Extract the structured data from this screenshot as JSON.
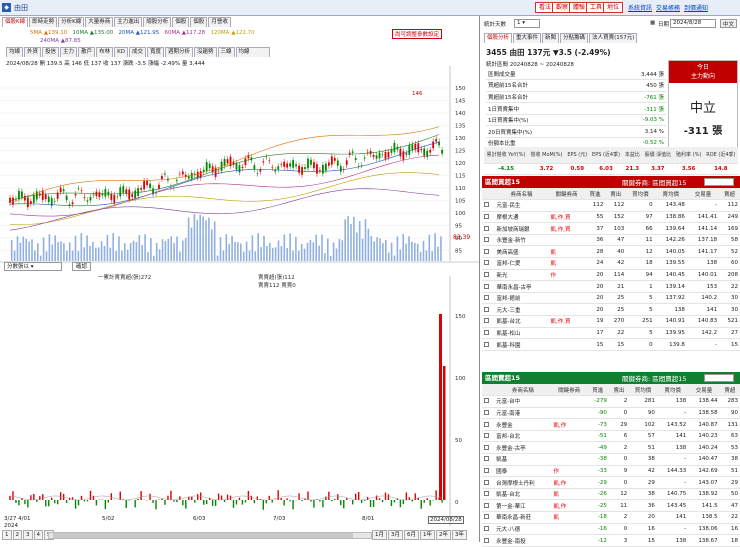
{
  "app": {
    "icon": "app-icon",
    "title": "由田",
    "links": [
      "看法",
      "觀察",
      "體驗",
      "工具",
      "地位"
    ],
    "top_links": [
      "系統資訊",
      "交易帳務",
      "到價通知"
    ]
  },
  "left": {
    "tabs": [
      "個股K線",
      "即時走勢",
      "分析K線",
      "大量券商",
      "主力進出",
      "總股分析",
      "個股",
      "個股",
      "月營收"
    ],
    "subtabs": [
      "均線",
      "外資",
      "投信",
      "主力",
      "散戶",
      "布林",
      "KD",
      "成交",
      "寬度",
      "週期分析",
      "沒趨勢",
      "三線",
      "均線"
    ],
    "ma_legend": [
      "5MA ▲139.10",
      "10MA ▲135.00",
      "20MA ▲121.95",
      "60MA ▲117.28",
      "240MA ▲87.85",
      "120MA ▲122.70"
    ],
    "ma_legend2": "240MA ▲87.85",
    "info": "2024/08/28  開 139.5  高 146  低 137  收 137   漲跌 -3.5  漲幅 -2.49%  量 3,444",
    "alert_link": "尚可調整參數設定",
    "price_ticks": [
      "150",
      "145",
      "140",
      "135",
      "130",
      "125",
      "120",
      "115",
      "110",
      "105",
      "100",
      "95",
      "90",
      "85"
    ],
    "last_price": "83.39",
    "high_label": "146",
    "vol_selector": "分數張以",
    "vol_legend": "一累計賣賣超(張)272",
    "vol_legend2": "賣賣超(張)112",
    "vol_legend3": "賣賣112 賣賣0",
    "sub_ticks": [
      "150",
      "100",
      "50",
      "0"
    ],
    "dates": [
      "3/27 4/01",
      "5/02",
      "6/03",
      "7/03",
      "8/01",
      "2024/08/28"
    ],
    "year": "2024",
    "pages": [
      "1",
      "2",
      "3",
      "4",
      "5"
    ],
    "ranges": [
      "1月",
      "3月",
      "6月",
      "1年",
      "2年",
      "3年"
    ]
  },
  "right": {
    "stat_title": "統計天數",
    "stat_days": "1",
    "date_label": "日期",
    "date_value": "2024/8/28",
    "next_btn": "中文",
    "tabs": [
      "個股分析",
      "重大事件",
      "新聞",
      "分點籌碼",
      "法人買賣(157元)"
    ],
    "stock_line": "3455 由田  137元 ▼3.5 (-2.49%)",
    "stat_period": "統計區間  20240828 ~ 20240828",
    "stats": [
      [
        "區間成交量",
        "3,444 張"
      ],
      [
        "買超前15名合計",
        "450 張"
      ],
      [
        "賣超前15名合計",
        "-761 張"
      ],
      [
        "1日買賣集中",
        "-311 張"
      ],
      [
        "1日買賣集中(%)",
        "-9.03 %"
      ],
      [
        "20日買賣集中(%)",
        "3.14 %"
      ],
      [
        "份額本比重",
        "-0.52 %"
      ],
      [
        "區間周轉率",
        "5.75 %"
      ]
    ],
    "main_label": "今日\n主力動向",
    "main_status": "中立",
    "main_value": "-311 張",
    "fund_heads": [
      "累計營收 YoY(%)",
      "營收 MoM(%)",
      "EPS (元)",
      "EPS (近4季)",
      "本益比",
      "股價 淨值比",
      "殖利率 (%)",
      "ROE (近4季)"
    ],
    "fund_vals": [
      "-4.15",
      "3.72",
      "0.59",
      "6.03",
      "21.3",
      "3.37",
      "3.56",
      "14.8"
    ],
    "buy_title": "區間買超15",
    "buy_select": "關鍵券商: 區間買超15",
    "sell_title": "區間賣超15",
    "sell_select": "關鍵券商: 區間賣超15",
    "cols": [
      "券商名稱",
      "關鍵券商",
      "買進",
      "賣出",
      "買均價",
      "賣均價",
      "交易量",
      "賣超"
    ],
    "buy_rows": [
      [
        "元富-民生",
        "",
        "112",
        "112",
        "0",
        "143.48",
        "-",
        "112",
        "-72"
      ],
      [
        "摩根大通",
        "凱,作,買",
        "55",
        "152",
        "97",
        "138.86",
        "141.41",
        "249",
        "15"
      ],
      [
        "新加坡商瑞銀",
        "凱,作,買",
        "37",
        "103",
        "66",
        "139.64",
        "141.14",
        "169",
        "0"
      ],
      [
        "永豐金-新竹",
        "",
        "36",
        "47",
        "11",
        "142.26",
        "137.18",
        "58",
        "-24"
      ],
      [
        "美商高盛",
        "凱",
        "28",
        "40",
        "12",
        "140.05",
        "141.17",
        "52",
        "-7"
      ],
      [
        "富邦-仁愛",
        "凱",
        "24",
        "42",
        "18",
        "139.55",
        "138",
        "60",
        "-9"
      ],
      [
        "新光",
        "作",
        "20",
        "114",
        "94",
        "140.45",
        "140.01",
        "208",
        "-11"
      ],
      [
        "華南永昌-古亭",
        "",
        "20",
        "21",
        "1",
        "139.14",
        "153",
        "22",
        "3"
      ],
      [
        "富邦-館前",
        "",
        "20",
        "25",
        "5",
        "137.92",
        "140.2",
        "30",
        "-1"
      ],
      [
        "元大-三重",
        "",
        "20",
        "25",
        "5",
        "138",
        "141",
        "30",
        "-11"
      ],
      [
        "凱基-台北",
        "凱,作,買",
        "19",
        "270",
        "251",
        "140.91",
        "140.83",
        "521",
        "-9"
      ],
      [
        "凱基-松山",
        "",
        "17",
        "22",
        "5",
        "139.95",
        "142.2",
        "27",
        "-4"
      ],
      [
        "凱基-科園",
        "",
        "15",
        "15",
        "0",
        "139.8",
        "-",
        "15",
        "-4"
      ]
    ],
    "sell_rows": [
      [
        "元富-台中",
        "",
        "-279",
        "2",
        "281",
        "138",
        "138.44",
        "283",
        "40"
      ],
      [
        "元富-南港",
        "",
        "-90",
        "0",
        "90",
        "-",
        "138.58",
        "90",
        "14"
      ],
      [
        "永豐金",
        "凱,作",
        "-73",
        "29",
        "102",
        "143.52",
        "140.87",
        "131",
        "21"
      ],
      [
        "富邦-台北",
        "",
        "-51",
        "6",
        "57",
        "141",
        "140.23",
        "63",
        "16"
      ],
      [
        "永豐金-古亭",
        "",
        "-49",
        "2",
        "51",
        "138",
        "140.24",
        "53",
        "16"
      ],
      [
        "凱基",
        "",
        "-38",
        "0",
        "38",
        "-",
        "140.47",
        "38",
        "13"
      ],
      [
        "國泰",
        "作",
        "-33",
        "9",
        "42",
        "144.33",
        "142.69",
        "51",
        "17"
      ],
      [
        "台灣摩根士丹利",
        "凱,作",
        "-29",
        "0",
        "29",
        "-",
        "143.07",
        "29",
        "18"
      ],
      [
        "凱基-台北",
        "凱",
        "-26",
        "12",
        "38",
        "140.75",
        "138.92",
        "50",
        "3"
      ],
      [
        "第一金-華江",
        "凱,作",
        "-25",
        "11",
        "36",
        "143.45",
        "141.5",
        "47",
        "18"
      ],
      [
        "華南永昌-新莊",
        "凱",
        "-18",
        "2",
        "20",
        "141",
        "138.5",
        "22",
        "4"
      ],
      [
        "元大-八德",
        "",
        "-16",
        "0",
        "16",
        "-",
        "138.06",
        "16",
        "2"
      ],
      [
        "永豐金-南投",
        "",
        "-12",
        "3",
        "15",
        "138",
        "138.67",
        "18",
        "2"
      ]
    ]
  }
}
